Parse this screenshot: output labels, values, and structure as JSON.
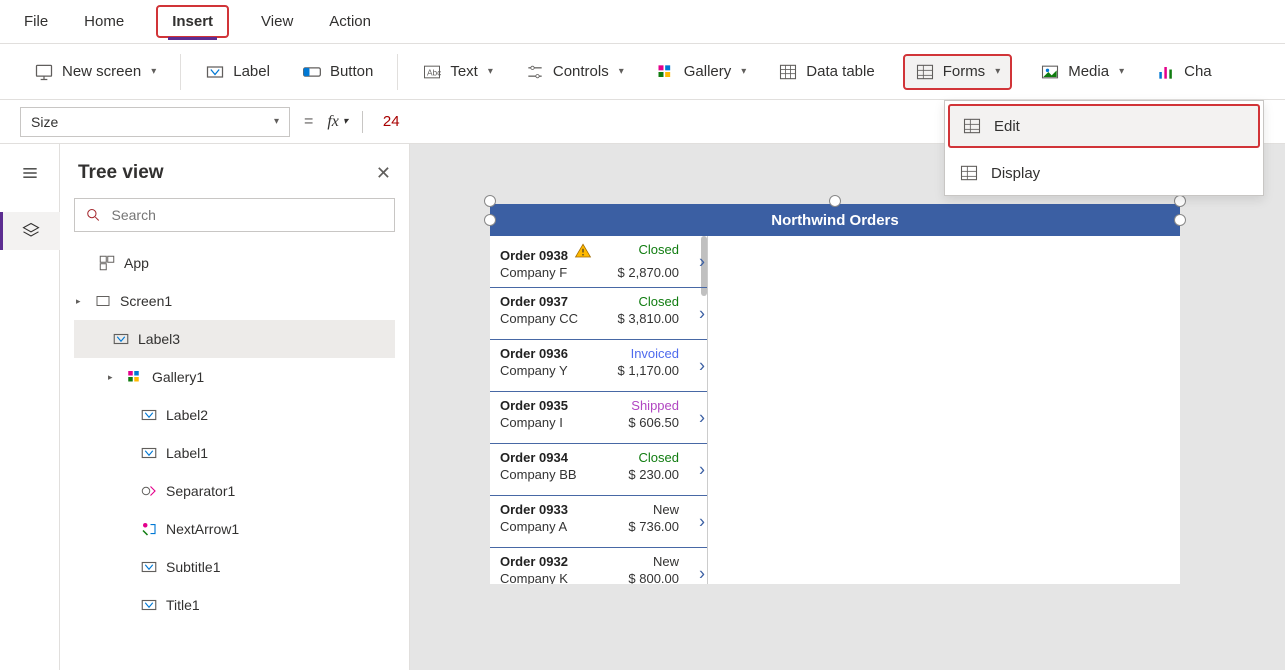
{
  "menubar": {
    "items": [
      "File",
      "Home",
      "Insert",
      "View",
      "Action"
    ],
    "active": "Insert"
  },
  "ribbon": {
    "new_screen": "New screen",
    "label": "Label",
    "button": "Button",
    "text": "Text",
    "controls": "Controls",
    "gallery": "Gallery",
    "data_table": "Data table",
    "forms": "Forms",
    "media": "Media",
    "charts": "Cha"
  },
  "forms_dropdown": {
    "edit": "Edit",
    "display": "Display"
  },
  "formula": {
    "property": "Size",
    "value": "24"
  },
  "tree": {
    "title": "Tree view",
    "search_placeholder": "Search",
    "app": "App",
    "screen1": "Screen1",
    "label3": "Label3",
    "gallery1": "Gallery1",
    "label2": "Label2",
    "label1": "Label1",
    "separator1": "Separator1",
    "nextarrow1": "NextArrow1",
    "subtitle1": "Subtitle1",
    "title1": "Title1"
  },
  "app": {
    "title": "Northwind Orders",
    "orders": [
      {
        "id": "Order 0938",
        "warn": true,
        "status": "Closed",
        "company": "Company F",
        "amount": "$ 2,870.00"
      },
      {
        "id": "Order 0937",
        "warn": false,
        "status": "Closed",
        "company": "Company CC",
        "amount": "$ 3,810.00"
      },
      {
        "id": "Order 0936",
        "warn": false,
        "status": "Invoiced",
        "company": "Company Y",
        "amount": "$ 1,170.00"
      },
      {
        "id": "Order 0935",
        "warn": false,
        "status": "Shipped",
        "company": "Company I",
        "amount": "$ 606.50"
      },
      {
        "id": "Order 0934",
        "warn": false,
        "status": "Closed",
        "company": "Company BB",
        "amount": "$ 230.00"
      },
      {
        "id": "Order 0933",
        "warn": false,
        "status": "New",
        "company": "Company A",
        "amount": "$ 736.00"
      },
      {
        "id": "Order 0932",
        "warn": false,
        "status": "New",
        "company": "Company K",
        "amount": "$ 800.00"
      }
    ]
  }
}
